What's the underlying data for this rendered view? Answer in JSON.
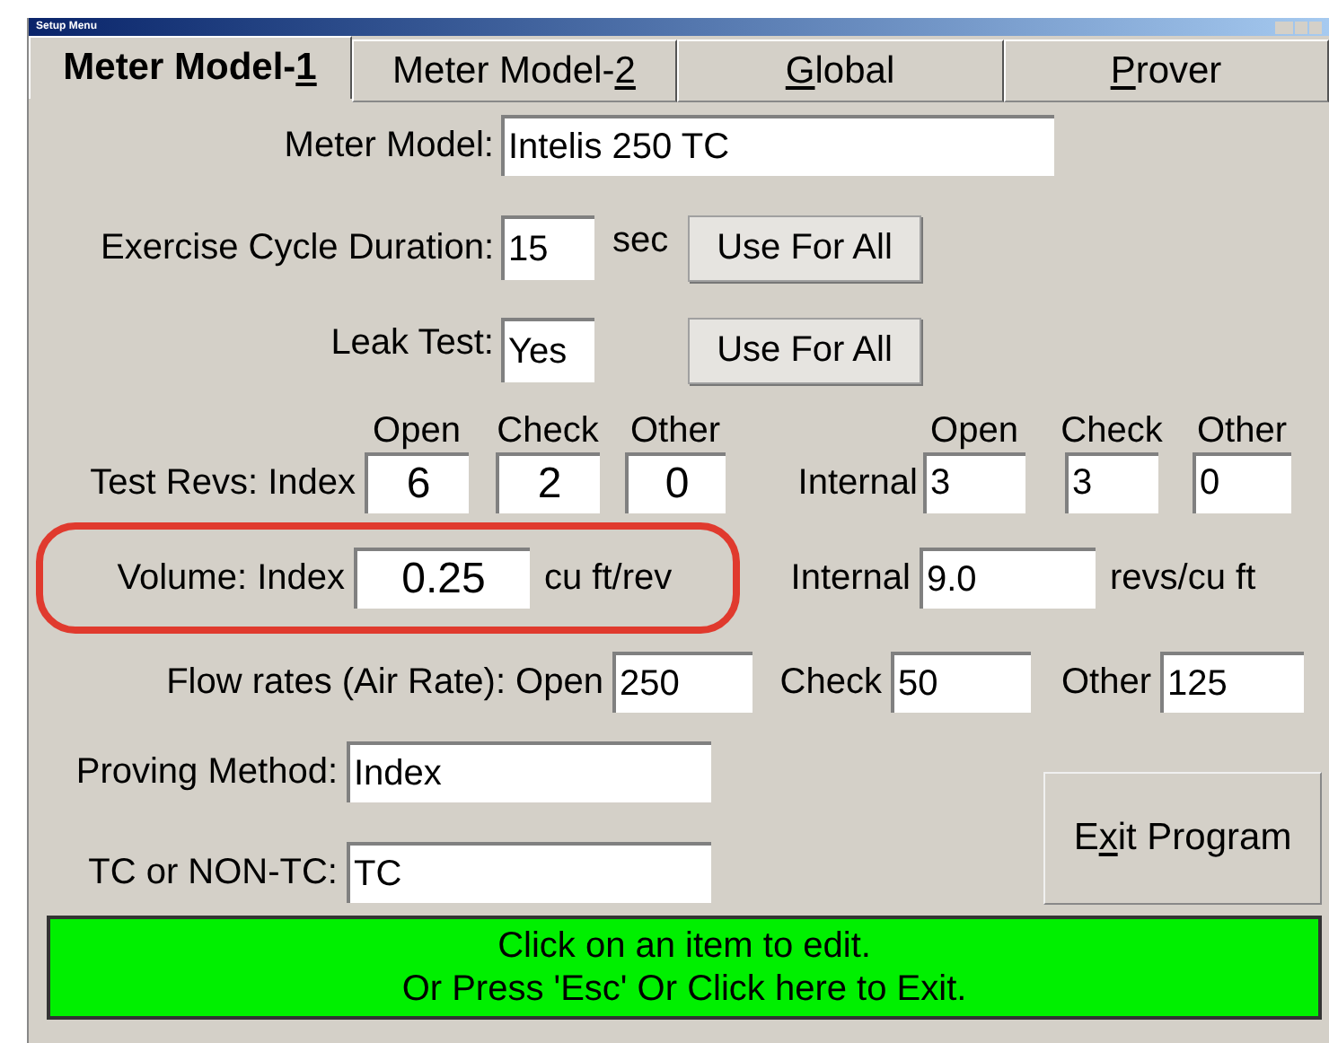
{
  "window": {
    "title": "Setup Menu"
  },
  "tabs": [
    {
      "before": "Meter Model-",
      "access_key": "1",
      "selected": true
    },
    {
      "before": "Meter Model-",
      "access_key": "2",
      "selected": false
    },
    {
      "access_key": "G",
      "after": "lobal",
      "selected": false
    },
    {
      "access_key": "P",
      "after": "rover",
      "selected": false
    }
  ],
  "meter_model": {
    "label": "Meter Model:",
    "value": "Intelis 250 TC"
  },
  "exercise_cycle": {
    "label": "Exercise Cycle Duration:",
    "value": "15",
    "unit": "sec",
    "button": "Use For All"
  },
  "leak_test": {
    "label": "Leak Test:",
    "value": "Yes",
    "button": "Use For All"
  },
  "test_revs": {
    "label": "Test Revs: Index",
    "index": [
      {
        "header": "Open",
        "value": "6"
      },
      {
        "header": "Check",
        "value": "2"
      },
      {
        "header": "Other",
        "value": "0"
      }
    ],
    "internal_label": "Internal",
    "internal": [
      {
        "header": "Open",
        "value": "3"
      },
      {
        "header": "Check",
        "value": "3"
      },
      {
        "header": "Other",
        "value": "0"
      }
    ]
  },
  "volume": {
    "label": "Volume: Index",
    "value": "0.25",
    "unit": "cu ft/rev",
    "highlighted": true,
    "internal_label": "Internal",
    "internal_value": "9.0",
    "internal_unit": "revs/cu ft"
  },
  "flow_rates": {
    "label": "Flow rates (Air Rate):  Open",
    "open": "250",
    "check_label": "Check",
    "check": "50",
    "other_label": "Other",
    "other": "125"
  },
  "proving_method": {
    "label": "Proving Method:",
    "value": "Index"
  },
  "tc": {
    "label": "TC or NON-TC:",
    "value": "TC"
  },
  "exit_button": {
    "before": "E",
    "access_key": "x",
    "after": "it Program"
  },
  "status": {
    "line_1": "Click on an item to edit.",
    "line_2": "Or Press 'Esc' Or Click here to Exit."
  }
}
